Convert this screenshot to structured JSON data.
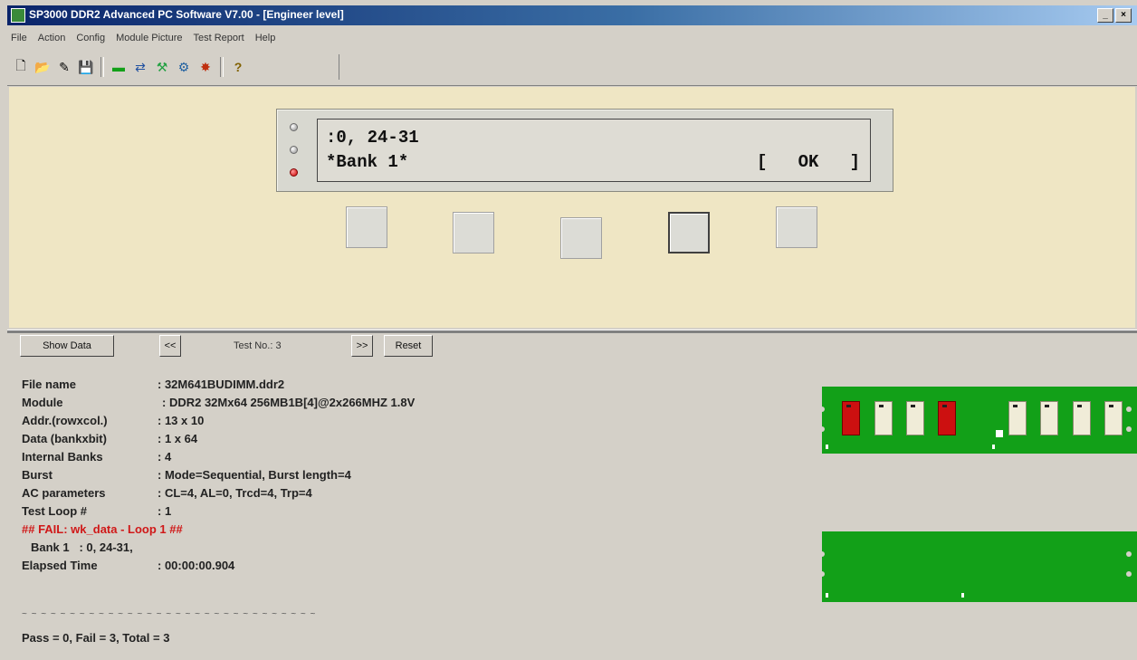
{
  "window": {
    "title": "SP3000 DDR2 Advanced PC Software V7.00 - [Engineer level]",
    "buttons": [
      "_",
      "×"
    ]
  },
  "menu": [
    "File",
    "Action",
    "Config",
    "Module Picture",
    "Test Report",
    "Help"
  ],
  "toolbar": {
    "icons": [
      "new-file-icon",
      "open-folder-icon",
      "edit-icon",
      "save-icon",
      "module-icon",
      "transfer-icon",
      "tools-icon",
      "settings-icon",
      "run-icon",
      "help-icon"
    ],
    "glyphs": [
      "🗋",
      "📂",
      "✎",
      "💾",
      "▬",
      "⇄",
      "⚒",
      "⚙",
      "✸",
      "?"
    ]
  },
  "lcd": {
    "line1": ":0, 24-31",
    "line2": "*Bank 1*",
    "ok": "[   OK   ]",
    "leds": [
      "off",
      "off",
      "red"
    ]
  },
  "controls": {
    "show_data": "Show Data",
    "prev": "<<",
    "test_no": "Test No.: 3",
    "next": ">>",
    "reset": "Reset"
  },
  "info": [
    {
      "label": "File name",
      "value": ": 32M641BUDIMM.ddr2"
    },
    {
      "label": "Module",
      "value": ": DDR2 32Mx64 256MB1B[4]@2x266MHZ 1.8V"
    },
    {
      "label": "Addr.(rowxcol.)",
      "value": ": 13 x 10"
    },
    {
      "label": "Data (bankxbit)",
      "value": ": 1 x 64"
    },
    {
      "label": "Internal Banks",
      "value": ": 4"
    },
    {
      "label": "Burst",
      "value": ": Mode=Sequential, Burst length=4"
    },
    {
      "label": "AC parameters",
      "value": ": CL=4, AL=0, Trcd=4, Trp=4"
    },
    {
      "label": "Test Loop #",
      "value": ": 1"
    }
  ],
  "fail_line": "## FAIL: wk_data - Loop 1 ##",
  "bank_line": "Bank 1   : 0, 24-31,",
  "elapsed": {
    "label": "Elapsed Time",
    "value": ": 00:00:00.904"
  },
  "separator": "~ ~ ~ ~ ~ ~ ~ ~ ~ ~ ~ ~ ~ ~ ~ ~ ~ ~ ~ ~ ~ ~ ~ ~ ~ ~ ~ ~ ~ ~ ~",
  "summary": "Pass = 0, Fail = 3, Total = 3",
  "module_picture": {
    "chip_states": [
      "fail",
      "ok",
      "ok",
      "fail",
      "ok",
      "ok",
      "ok",
      "ok"
    ],
    "colors": {
      "board": "#12a018",
      "chip_ok": "#f0ecd8",
      "chip_fail": "#cc1010"
    }
  }
}
